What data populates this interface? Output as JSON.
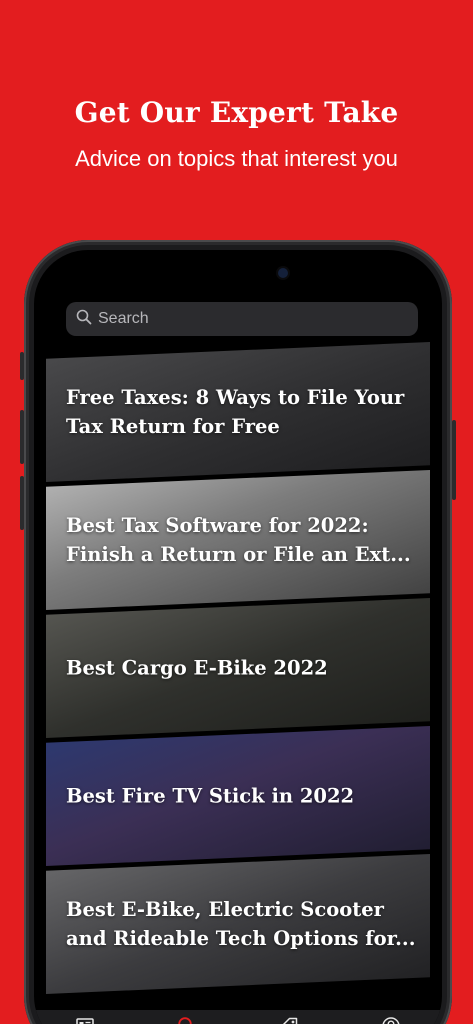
{
  "promo": {
    "title": "Get Our Expert Take",
    "subtitle": "Advice on topics that interest you"
  },
  "search": {
    "placeholder": "Search"
  },
  "articles": [
    {
      "title": "Free Taxes: 8 Ways to File Your\nTax Return for Free"
    },
    {
      "title": "Best Tax Software for 2022:\nFinish a Return or File an Ext..."
    },
    {
      "title": "Best Cargo E-Bike 2022"
    },
    {
      "title": "Best Fire TV Stick in 2022"
    },
    {
      "title": "Best E-Bike, Electric Scooter\nand Rideable Tech Options for..."
    }
  ],
  "tabs": [
    {
      "icon": "news-icon",
      "active": false
    },
    {
      "icon": "search-icon",
      "active": true
    },
    {
      "icon": "tag-icon",
      "active": false
    },
    {
      "icon": "profile-icon",
      "active": false
    }
  ],
  "colors": {
    "brand": "#e31d1f",
    "active_tab": "#e31d1f",
    "inactive_tab": "#e6e6e6"
  }
}
